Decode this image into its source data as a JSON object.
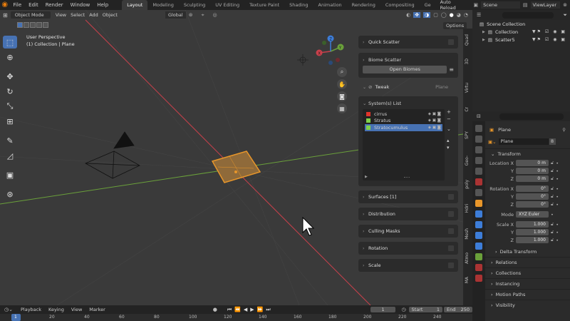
{
  "topbar": {
    "menus": [
      "File",
      "Edit",
      "Render",
      "Window",
      "Help"
    ],
    "workspaces": [
      "Layout",
      "Modeling",
      "Sculpting",
      "UV Editing",
      "Texture Paint",
      "Shading",
      "Animation",
      "Rendering",
      "Compositing",
      "Ge"
    ],
    "active_workspace": "Layout",
    "auto_reload": "Auto Reload",
    "scene": "Scene",
    "view_layer": "ViewLayer"
  },
  "viewport": {
    "mode": "Object Mode",
    "menus": [
      "View",
      "Select",
      "Add",
      "Object"
    ],
    "transform": "Global",
    "options": "Options",
    "info_line1": "User Perspective",
    "info_line2": "(1) Collection | Plane",
    "gizmo_axes": [
      "Y",
      "X",
      "Z"
    ]
  },
  "npanel": {
    "panels": {
      "quick_scatter": "Quick Scatter",
      "biome_scatter": "Biome Scatter",
      "open_biomes": "Open Biomes",
      "tweak": "Tweak",
      "tweak_target": "Plane",
      "systems_list": "System(s) List",
      "surfaces": "Surfaces [1]",
      "distribution": "Distribution",
      "culling_masks": "Culling Masks",
      "rotation": "Rotation",
      "scale": "Scale"
    },
    "systems": [
      {
        "name": "cirrus",
        "color": "#e0342b"
      },
      {
        "name": "Stratus",
        "color": "#7fd04a"
      },
      {
        "name": "Stratocumulus",
        "color": "#7fd04a"
      }
    ],
    "side_tabs": [
      "Quad",
      "3D",
      "Virtu",
      "Cr",
      "SPY",
      "Geo-",
      "poly",
      "Hdri",
      "Mesh",
      "Atmo",
      "MA"
    ]
  },
  "outliner": {
    "root": "Scene Collection",
    "items": [
      "Collection",
      "Scatter5"
    ]
  },
  "properties": {
    "object_name": "Plane",
    "data_name": "Plane",
    "user_count": "8",
    "transform_title": "Transform",
    "location": {
      "label_x": "Location X",
      "x": "0 m",
      "y": "0 m",
      "z": "0 m"
    },
    "rotation": {
      "label_x": "Rotation X",
      "x": "0°",
      "y": "0°",
      "z": "0°"
    },
    "mode_label": "Mode",
    "mode": "XYZ Euler",
    "scale": {
      "label_x": "Scale X",
      "x": "1.000",
      "y": "1.000",
      "z": "1.000"
    },
    "axis_y": "Y",
    "axis_z": "Z",
    "delta": "Delta Transform",
    "sections": [
      "Relations",
      "Collections",
      "Instancing",
      "Motion Paths",
      "Visibility"
    ]
  },
  "timeline": {
    "menus": [
      "Playback",
      "Keying",
      "View",
      "Marker"
    ],
    "current_frame": "1",
    "start_label": "Start",
    "start": "1",
    "end_label": "End",
    "end": "250",
    "ruler": [
      "1",
      "20",
      "40",
      "60",
      "80",
      "100",
      "120",
      "140",
      "160",
      "180",
      "200",
      "220",
      "240"
    ]
  },
  "colors": {
    "accent": "#4772b3",
    "selection": "#e8962a",
    "x_axis": "#c8404b",
    "y_axis": "#6aa03a"
  }
}
